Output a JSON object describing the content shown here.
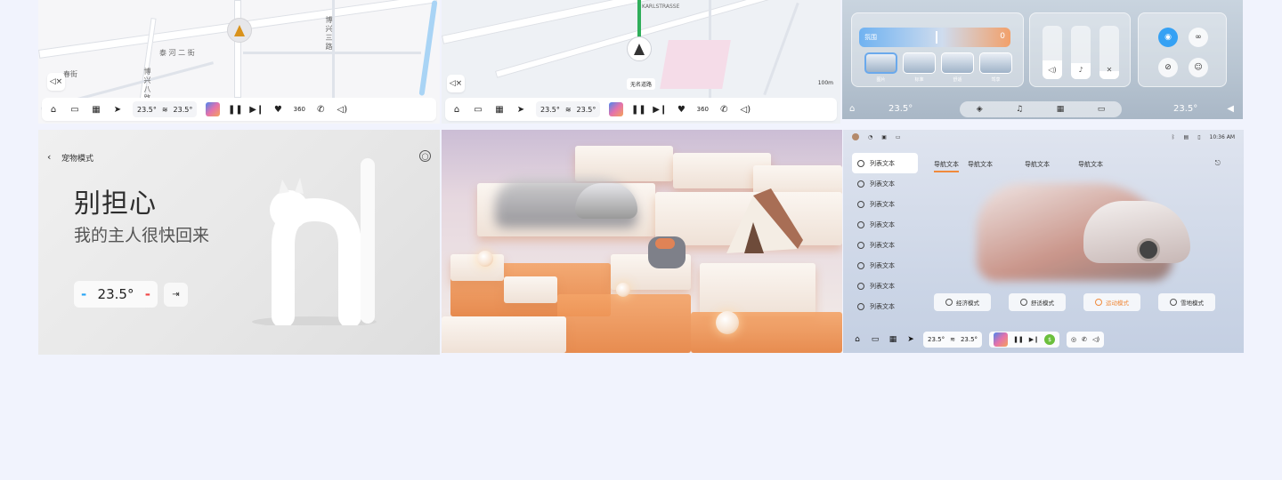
{
  "panel1": {
    "labels": {
      "street1": "泰 河 二 街",
      "street2": "博兴三路",
      "street3": "博兴八路",
      "street4": "春街"
    },
    "dock": {
      "temp_left": "23.5°",
      "temp_right": "23.5°",
      "camera_label": "360"
    }
  },
  "panel2": {
    "labels": {
      "street": "KARLSTRASSE",
      "road_name": "无名道路",
      "scale": "100m"
    },
    "dock": {
      "temp_left": "23.5°",
      "temp_right": "23.5°",
      "camera_label": "360"
    }
  },
  "panel3": {
    "slider_label": "氛围",
    "slider_value": "0",
    "slider_level": 0.5,
    "thumbs": [
      "图片",
      "标准",
      "舒适",
      "驾享"
    ],
    "levels": {
      "volume": 0.35,
      "mic": 0.3,
      "voice": 0.15
    },
    "dock": {
      "temp_left": "23.5°",
      "temp_right": "23.5°"
    }
  },
  "panel4": {
    "page_title": "宠物模式",
    "headline": "别担心",
    "subline": "我的主人很快回来",
    "temperature": "23.5°",
    "minus": "-",
    "plus": "-"
  },
  "panel6": {
    "clock": "10:36 AM",
    "list_items": [
      "列表文本",
      "列表文本",
      "列表文本",
      "列表文本",
      "列表文本",
      "列表文本",
      "列表文本",
      "列表文本"
    ],
    "tabs": [
      "导航文本",
      "导航文本",
      "导航文本",
      "导航文本"
    ],
    "modes": [
      "经济模式",
      "舒适模式",
      "运动模式",
      "雪地模式"
    ],
    "dock": {
      "temp_left": "23.5°",
      "temp_right": "23.5°"
    }
  },
  "colors": {
    "accent_orange": "#f08a3c",
    "accent_blue": "#35a1f4",
    "heart_red": "#e23b4d",
    "page_bg": "#f1f3fd"
  },
  "icons": [
    "home-icon",
    "car-icon",
    "apps-icon",
    "navigate-icon",
    "fan-icon",
    "play-pause-icon",
    "next-icon",
    "heart-icon",
    "camera-360-icon",
    "phone-icon",
    "volume-icon",
    "mute-icon",
    "back-icon",
    "settings-icon",
    "exit-icon",
    "wifi-icon",
    "link-icon",
    "eye-off-icon",
    "bluetooth-icon",
    "bell-icon",
    "lock-icon",
    "share-icon",
    "music-icon",
    "cube-icon",
    "mic-icon"
  ]
}
